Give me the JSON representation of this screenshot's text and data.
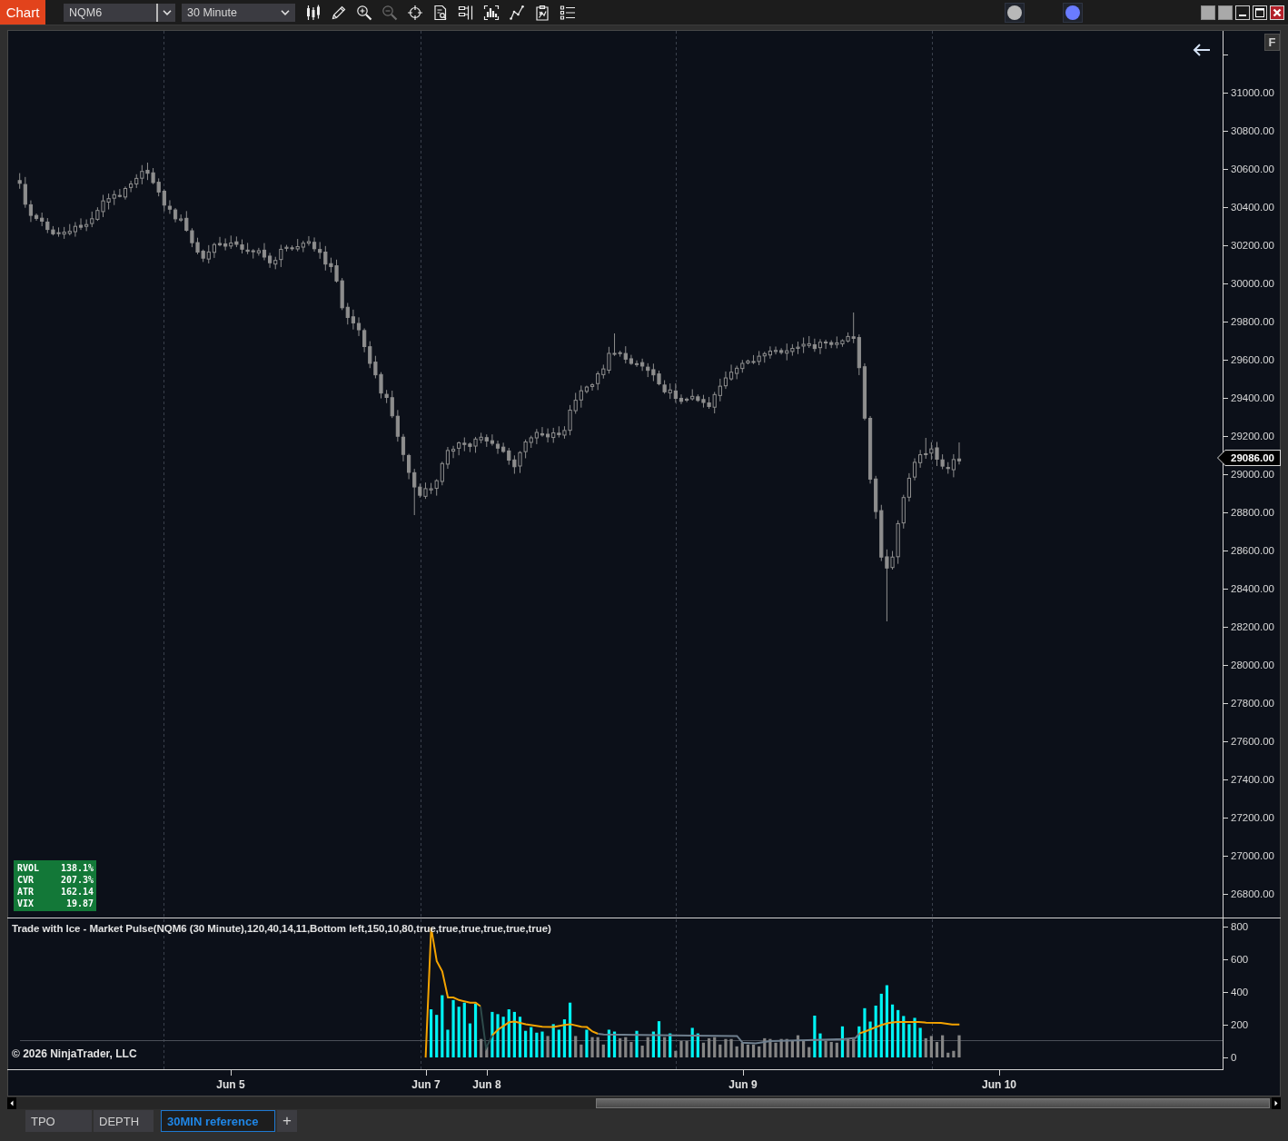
{
  "toolbar": {
    "menu_button": "Chart",
    "instrument": "NQM6",
    "interval": "30 Minute",
    "tools": [
      {
        "disabled": false
      },
      {
        "disabled": false
      },
      {
        "disabled": false
      },
      {
        "disabled": true
      },
      {
        "disabled": false
      },
      {
        "disabled": false
      },
      {
        "disabled": false
      },
      {
        "disabled": false
      },
      {
        "disabled": false
      },
      {
        "disabled": false
      },
      {
        "disabled": false
      }
    ],
    "status_lights": [
      {
        "color": "#b8b8b8"
      },
      {
        "color": "#6a7cff"
      }
    ]
  },
  "chart": {
    "collapse_button": "F",
    "price_axis": [
      "31000.00",
      "30800.00",
      "30600.00",
      "30400.00",
      "30200.00",
      "30000.00",
      "29800.00",
      "29600.00",
      "29400.00",
      "29200.00",
      "29000.00",
      "28800.00",
      "28600.00",
      "28400.00",
      "28200.00",
      "28000.00",
      "27800.00",
      "27600.00",
      "27400.00",
      "27200.00",
      "27000.00",
      "26800.00"
    ],
    "last_price": "29086.00",
    "stats": [
      {
        "label": "RVOL",
        "value": "138.1%"
      },
      {
        "label": "CVR",
        "value": "207.3%"
      },
      {
        "label": "ATR",
        "value": "162.14"
      },
      {
        "label": "VIX",
        "value": "19.87"
      }
    ],
    "indicator": {
      "title": "Trade with Ice - Market Pulse(NQM6 (30 Minute),120,40,14,11,Bottom left,150,10,80,true,true,true,true,true,true)",
      "axis": [
        "800",
        "600",
        "400",
        "200",
        "0"
      ]
    },
    "copyright": "© 2026 NinjaTrader, LLC",
    "time_axis": [
      "Jun 5",
      "Jun 7",
      "Jun 8",
      "Jun 9",
      "Jun 10"
    ]
  },
  "tabs": [
    {
      "label": "TPO",
      "selected": false
    },
    {
      "label": "DEPTH",
      "selected": false
    },
    {
      "label": "30MIN reference",
      "selected": true
    }
  ],
  "add_tab": "+"
}
